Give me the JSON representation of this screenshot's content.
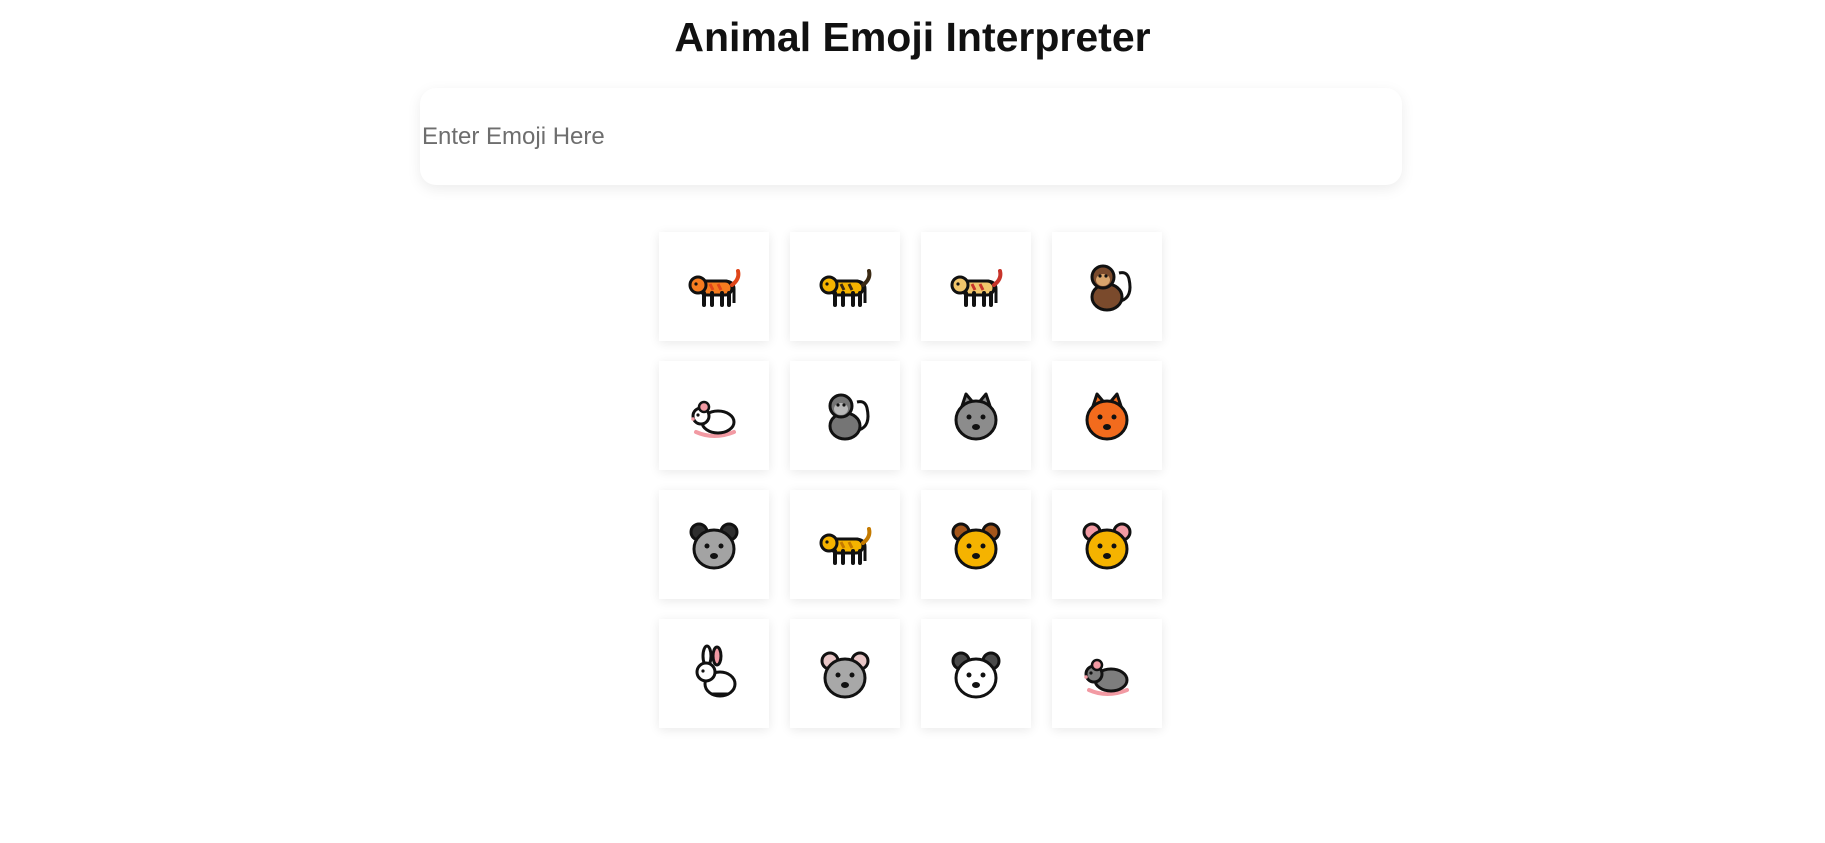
{
  "page": {
    "title": "Animal Emoji Interpreter"
  },
  "search": {
    "placeholder": "Enter Emoji Here",
    "value": ""
  },
  "animals": [
    {
      "name": "tiger",
      "emoji": "🐅",
      "icon": "tiger-icon",
      "body": "#f57c1f",
      "accent": "#e0461a"
    },
    {
      "name": "leopard",
      "emoji": "🐆",
      "icon": "leopard-icon",
      "body": "#f5b300",
      "accent": "#3b2a14"
    },
    {
      "name": "dog",
      "emoji": "🐕",
      "icon": "dog-icon",
      "body": "#f2c66b",
      "accent": "#c8342a"
    },
    {
      "name": "monkey",
      "emoji": "🐒",
      "icon": "monkey-icon",
      "body": "#7a4a2c",
      "accent": "#d8a46c"
    },
    {
      "name": "mouse",
      "emoji": "🐁",
      "icon": "mouse-icon",
      "body": "#ffffff",
      "accent": "#f29aa3"
    },
    {
      "name": "gorilla",
      "emoji": "🦍",
      "icon": "gorilla-icon",
      "body": "#757575",
      "accent": "#b8b8b8"
    },
    {
      "name": "wolf",
      "emoji": "🐺",
      "icon": "wolf-icon",
      "body": "#8c8c8c",
      "accent": "#ffffff"
    },
    {
      "name": "fox",
      "emoji": "🦊",
      "icon": "fox-icon",
      "body": "#f26b1d",
      "accent": "#ffffff"
    },
    {
      "name": "raccoon",
      "emoji": "🦝",
      "icon": "raccoon-icon",
      "body": "#a3a3a3",
      "accent": "#2e2e2e"
    },
    {
      "name": "cat",
      "emoji": "🐈",
      "icon": "cat-icon",
      "body": "#f5b300",
      "accent": "#c47a00"
    },
    {
      "name": "lion",
      "emoji": "🦁",
      "icon": "lion-icon",
      "body": "#f5b300",
      "accent": "#a4561a"
    },
    {
      "name": "hamster",
      "emoji": "🐹",
      "icon": "hamster-icon",
      "body": "#f5b300",
      "accent": "#f29aa3"
    },
    {
      "name": "rabbit",
      "emoji": "🐇",
      "icon": "rabbit-icon",
      "body": "#ffffff",
      "accent": "#f29aa3"
    },
    {
      "name": "koala",
      "emoji": "🐨",
      "icon": "koala-icon",
      "body": "#a8a8a8",
      "accent": "#e8c6c6"
    },
    {
      "name": "panda",
      "emoji": "🐼",
      "icon": "panda-icon",
      "body": "#ffffff",
      "accent": "#4a4a4a"
    },
    {
      "name": "rat",
      "emoji": "🐀",
      "icon": "rat-icon",
      "body": "#7d7d7d",
      "accent": "#f29aa3"
    }
  ]
}
